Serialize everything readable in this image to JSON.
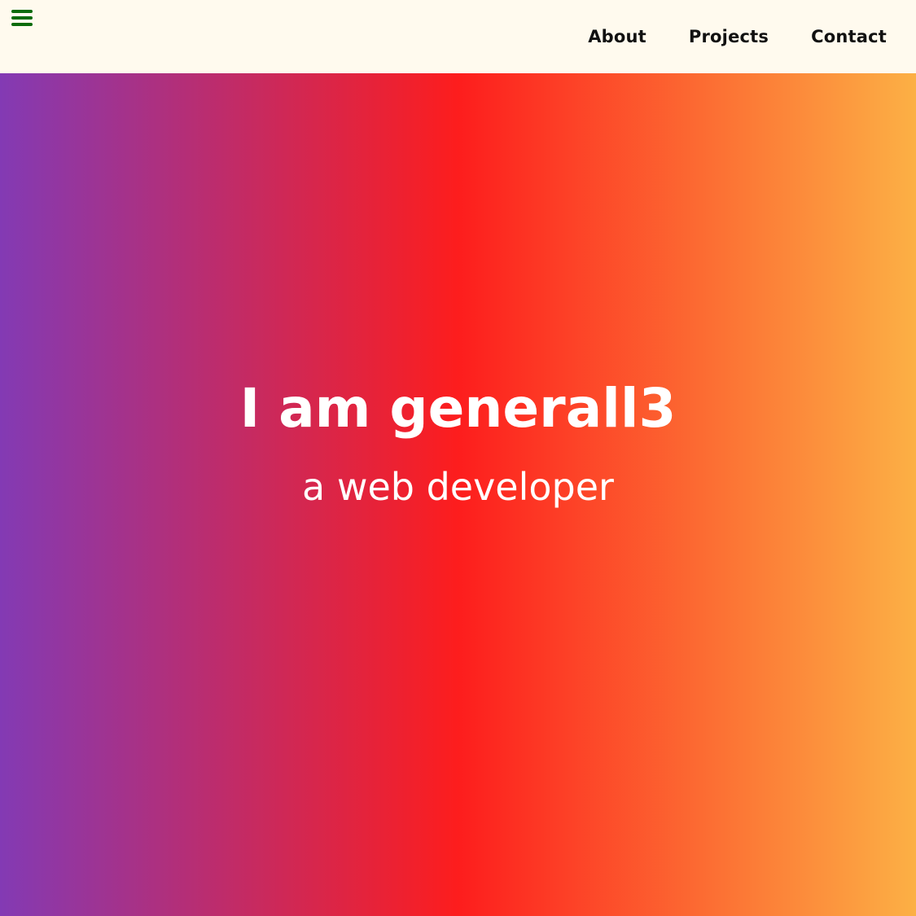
{
  "nav": {
    "menu_icon": "hamburger-menu-icon",
    "links": [
      {
        "label": "About"
      },
      {
        "label": "Projects"
      },
      {
        "label": "Contact"
      }
    ]
  },
  "hero": {
    "title": "I am generall3",
    "subtitle": "a web developer"
  },
  "colors": {
    "navbar_bg": "#fffaee",
    "menu_icon": "#0b6b0b",
    "gradient": [
      "#833ab4",
      "#fd1d1d",
      "#fcb045"
    ],
    "hero_text": "#ffffff"
  }
}
